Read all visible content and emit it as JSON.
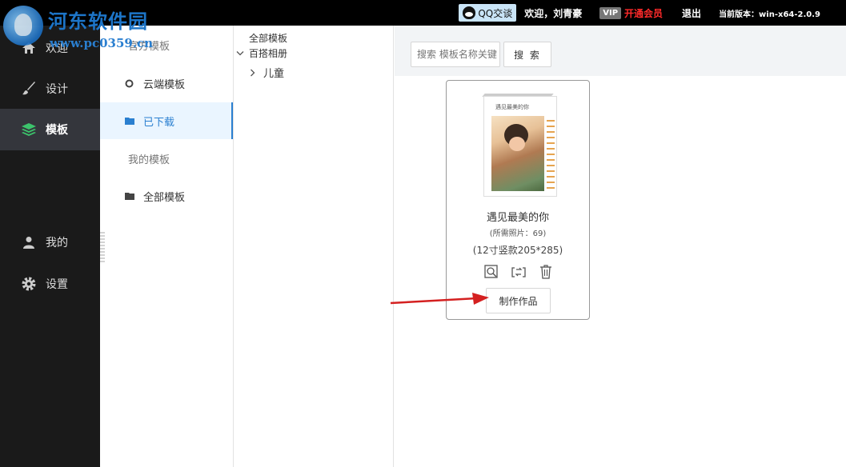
{
  "watermark": {
    "title": "河东软件园",
    "url": "www.pc0359.cn"
  },
  "topbar": {
    "qq_label": "QQ交谈",
    "welcome": "欢迎，刘青豪",
    "vip_badge": "VIP",
    "vip_label": "开通会员",
    "logout": "退出",
    "version": "当前版本：win-x64-2.0.9"
  },
  "sidebar": {
    "items": [
      {
        "label": "欢迎",
        "icon": "home-icon"
      },
      {
        "label": "设计",
        "icon": "brush-icon"
      },
      {
        "label": "模板",
        "icon": "layers-icon",
        "active": true
      },
      {
        "label": "我的",
        "icon": "user-icon"
      },
      {
        "label": "设置",
        "icon": "gear-icon"
      }
    ]
  },
  "template_panel": {
    "items": [
      {
        "label": "官方模板"
      },
      {
        "label": "云端模板",
        "icon": "cloud-icon"
      },
      {
        "label": "已下载",
        "icon": "folder-icon",
        "active": true
      },
      {
        "label": "我的模板"
      },
      {
        "label": "全部模板",
        "icon": "folder-icon"
      }
    ]
  },
  "tree": {
    "root": "全部模板",
    "group": "百搭相册",
    "child": "儿童"
  },
  "search": {
    "placeholder": "搜索 模板名称关键",
    "button": "搜 索"
  },
  "card": {
    "thumb_title": "遇见最美的你",
    "title": "遇见最美的你",
    "photos_needed": "(所需照片：69)",
    "size": "(12寸竖款205*285)",
    "action": "制作作品"
  },
  "colors": {
    "accent": "#2a7fd0",
    "vip": "#ff2a2a",
    "active_nav": "#34363c",
    "arrow": "#d42020"
  }
}
